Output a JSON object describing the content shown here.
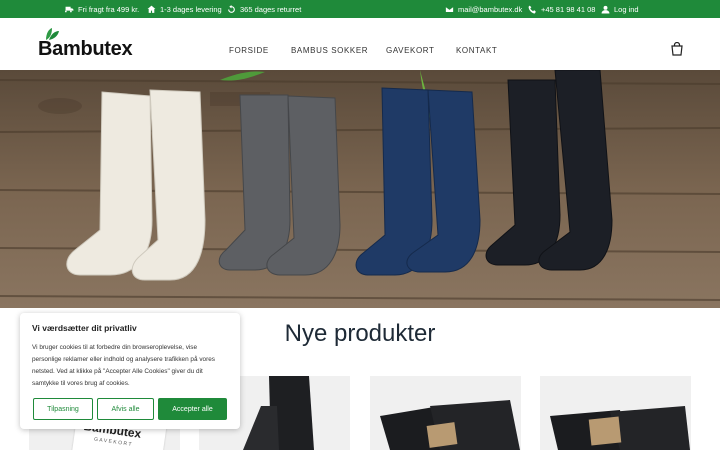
{
  "topbar": {
    "shipping": "Fri fragt fra 499 kr.",
    "delivery": "1-3 dages levering",
    "returns": "365 dages returret",
    "email": "mail@bambutex.dk",
    "phone": "+45 81 98 41 08",
    "login": "Log ind"
  },
  "header": {
    "logo": "Bambutex",
    "nav": [
      "FORSIDE",
      "BAMBUS SOKKER",
      "GAVEKORT",
      "KONTAKT"
    ]
  },
  "main": {
    "section_title": "Nye produkter",
    "giftcard_brand": "Bambutex",
    "giftcard_sub": "GAVEKORT"
  },
  "cookie": {
    "title": "Vi værdsætter dit privatliv",
    "text": "Vi bruger cookies til at forbedre din browseroplevelse, vise personlige reklamer eller indhold og analysere trafikken på vores netsted. Ved at klikke på \"Accepter Alle Cookies\" giver du dit samtykke til vores brug af cookies.",
    "customize": "Tilpasning",
    "reject": "Afvis alle",
    "accept": "Accepter alle"
  },
  "colors": {
    "brand_green": "#1f8a3a",
    "title_dark": "#1e2a36"
  },
  "icons": [
    "truck-icon",
    "home-icon",
    "refresh-icon",
    "mail-icon",
    "phone-icon",
    "user-icon",
    "leaf-icon",
    "shopping-bag-icon"
  ]
}
